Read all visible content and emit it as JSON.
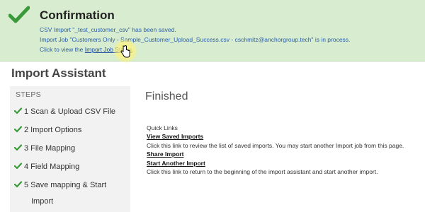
{
  "confirmation": {
    "title": "Confirmation",
    "line1": "CSV Import \"_test_customer_csv\" has been saved.",
    "line2": "Import Job \"Customers Only - Sample_Customer_Upload_Success.csv - cschmitz@anchorgroup.tech\" is in process.",
    "line3_prefix": "Click to view the ",
    "line3_link": "Import Job Status",
    "line3_suffix": ".",
    "icon": "checkmark-icon",
    "color": "#3a9a3a"
  },
  "page": {
    "title": "Import Assistant"
  },
  "steps": {
    "header": "STEPS",
    "items": [
      {
        "label": "1 Scan & Upload CSV File"
      },
      {
        "label": "2 Import Options"
      },
      {
        "label": "3 File Mapping"
      },
      {
        "label": "4 Field Mapping"
      },
      {
        "label": "5 Save mapping & Start",
        "label_cont": "Import"
      }
    ]
  },
  "main": {
    "status": "Finished",
    "quick_links_label": "Quick Links",
    "links": [
      {
        "label": "View Saved Imports",
        "desc": "Click this link to review the list of saved imports. You may start another Import job from this page."
      },
      {
        "label": "Share Import",
        "desc": ""
      },
      {
        "label": "Start Another Import",
        "desc": "Click this link to return to the beginning of the import assistant and start another import."
      }
    ]
  }
}
